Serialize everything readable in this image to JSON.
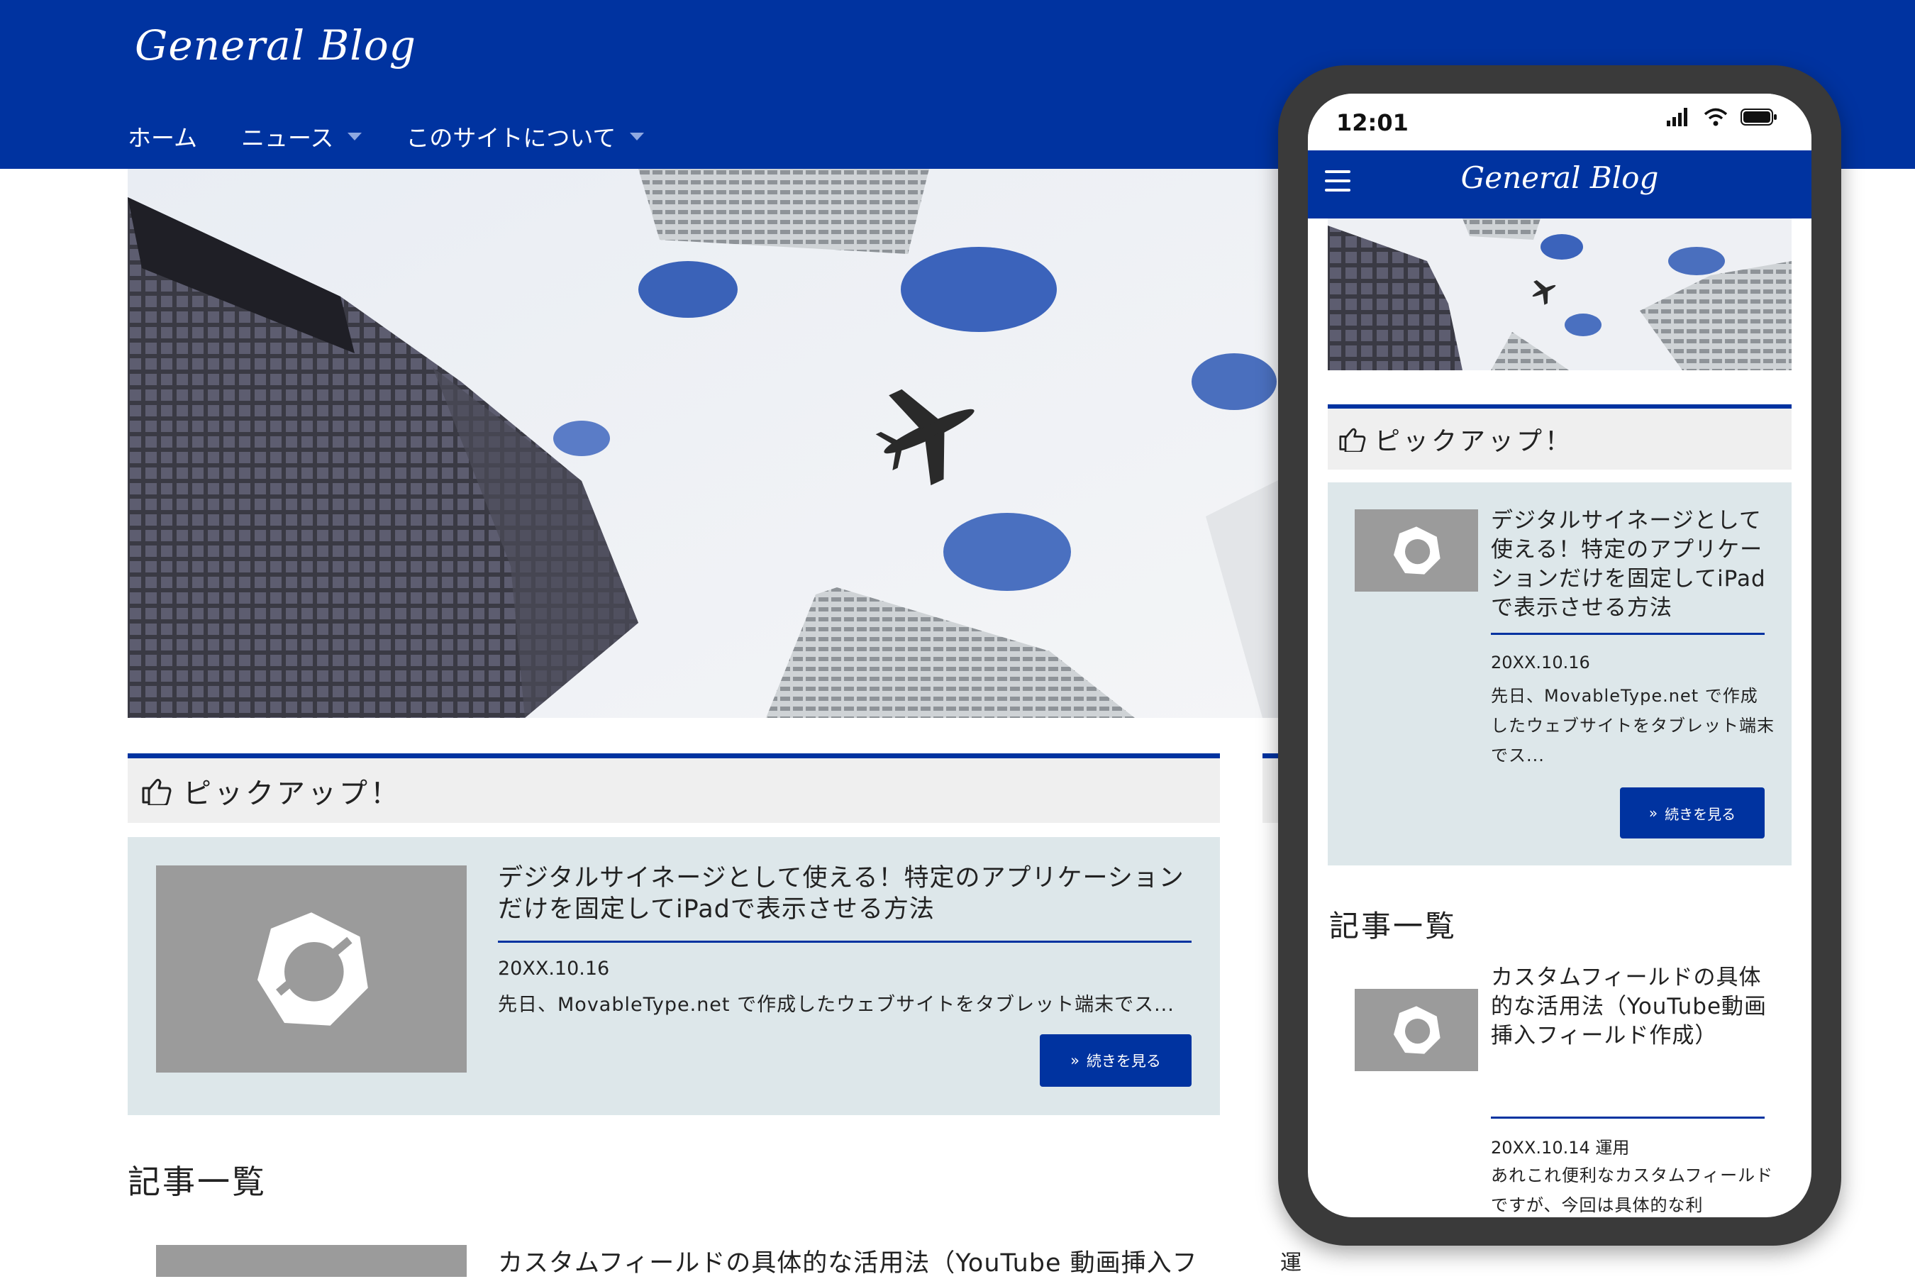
{
  "brand": {
    "logo_text": "General Blog",
    "accent_color": "#0033a0"
  },
  "nav": {
    "items": [
      {
        "label": "ホーム",
        "has_dropdown": false
      },
      {
        "label": "ニュース",
        "has_dropdown": true
      },
      {
        "label": "このサイトについて",
        "has_dropdown": true
      }
    ]
  },
  "pickup": {
    "heading": "ピックアップ！",
    "icon": "thumbs-up-pointing-icon",
    "card": {
      "title": "デジタルサイネージとして使える！特定のアプリケーションだけを固定してiPadで表示させる方法",
      "date": "20XX.10.16",
      "excerpt": "先日、MovableType.net で作成したウェブサイトをタブレット端末でス...",
      "button_label": "続きを見る"
    }
  },
  "list": {
    "heading": "記事一覧",
    "items": [
      {
        "title": "カスタムフィールドの具体的な活用法（YouTube 動画挿入フ"
      }
    ],
    "side_text": "運"
  },
  "mobile": {
    "status": {
      "time": "12:01"
    },
    "logo_text": "General Blog",
    "pickup": {
      "heading": "ピックアップ！",
      "title": "デジタルサイネージとして使える！特定のアプリケーションだけを固定してiPadで表示させる方法",
      "date": "20XX.10.16",
      "excerpt": "先日、MovableType.net で作成したウェブサイトをタブレット端末でス...",
      "button_label": "続きを見る"
    },
    "list": {
      "heading": "記事一覧",
      "item": {
        "title": "カスタムフィールドの具体的な活用法（YouTube動画挿入フィールド作成）",
        "date": "20XX.10.14 運用",
        "excerpt": "あれこれ便利なカスタムフィールドですが、今回は具体的な利"
      }
    }
  }
}
